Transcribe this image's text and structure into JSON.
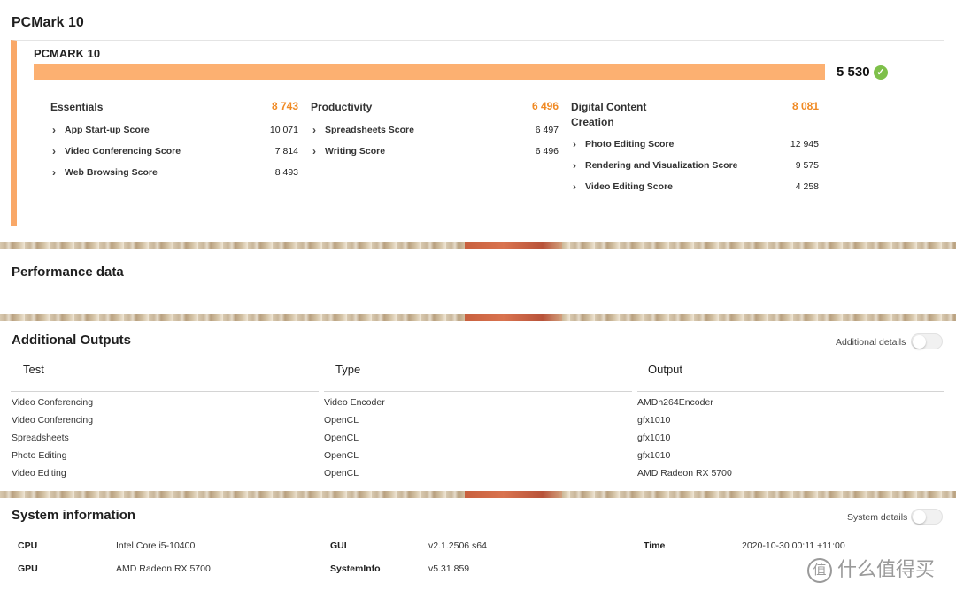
{
  "page_title": "PCMark 10",
  "card": {
    "title": "PCMARK 10",
    "total_score": "5 530",
    "bar_fill": 1.0,
    "groups": [
      {
        "name": "Essentials",
        "score": "8 743",
        "items": [
          {
            "label": "App Start-up Score",
            "value": "10 071"
          },
          {
            "label": "Video Conferencing Score",
            "value": "7 814"
          },
          {
            "label": "Web Browsing Score",
            "value": "8 493"
          }
        ]
      },
      {
        "name": "Productivity",
        "score": "6 496",
        "items": [
          {
            "label": "Spreadsheets Score",
            "value": "6 497"
          },
          {
            "label": "Writing Score",
            "value": "6 496"
          }
        ]
      },
      {
        "name": "Digital Content Creation",
        "score": "8 081",
        "items": [
          {
            "label": "Photo Editing Score",
            "value": "12 945"
          },
          {
            "label": "Rendering and Visualization Score",
            "value": "9 575"
          },
          {
            "label": "Video Editing Score",
            "value": "4 258"
          }
        ]
      }
    ]
  },
  "performance": {
    "title": "Performance data"
  },
  "additional": {
    "title": "Additional Outputs",
    "toggle_label": "Additional details",
    "headers": [
      "Test",
      "Type",
      "Output"
    ],
    "rows": [
      [
        "Video Conferencing",
        "Video Encoder",
        "AMDh264Encoder"
      ],
      [
        "Video Conferencing",
        "OpenCL",
        "gfx1010"
      ],
      [
        "Spreadsheets",
        "OpenCL",
        "gfx1010"
      ],
      [
        "Photo Editing",
        "OpenCL",
        "gfx1010"
      ],
      [
        "Video Editing",
        "OpenCL",
        "AMD Radeon RX 5700"
      ]
    ]
  },
  "system": {
    "title": "System information",
    "toggle_label": "System details",
    "cpu_label": "CPU",
    "cpu": "Intel Core i5-10400",
    "gpu_label": "GPU",
    "gpu": "AMD Radeon RX 5700",
    "gui_label": "GUI",
    "gui": "v2.1.2506 s64",
    "sysinfo_label": "SystemInfo",
    "sysinfo": "v5.31.859",
    "time_label": "Time",
    "time": "2020-10-30 00:11 +11:00"
  },
  "watermark": {
    "text": "什么值得买",
    "icon": "值"
  },
  "colors": {
    "accent_orange": "#f9a868",
    "score_orange": "#f08a24",
    "check_green": "#7ec04a"
  },
  "icons": {
    "check": "check-icon",
    "chevron": "chevron-right-icon"
  }
}
